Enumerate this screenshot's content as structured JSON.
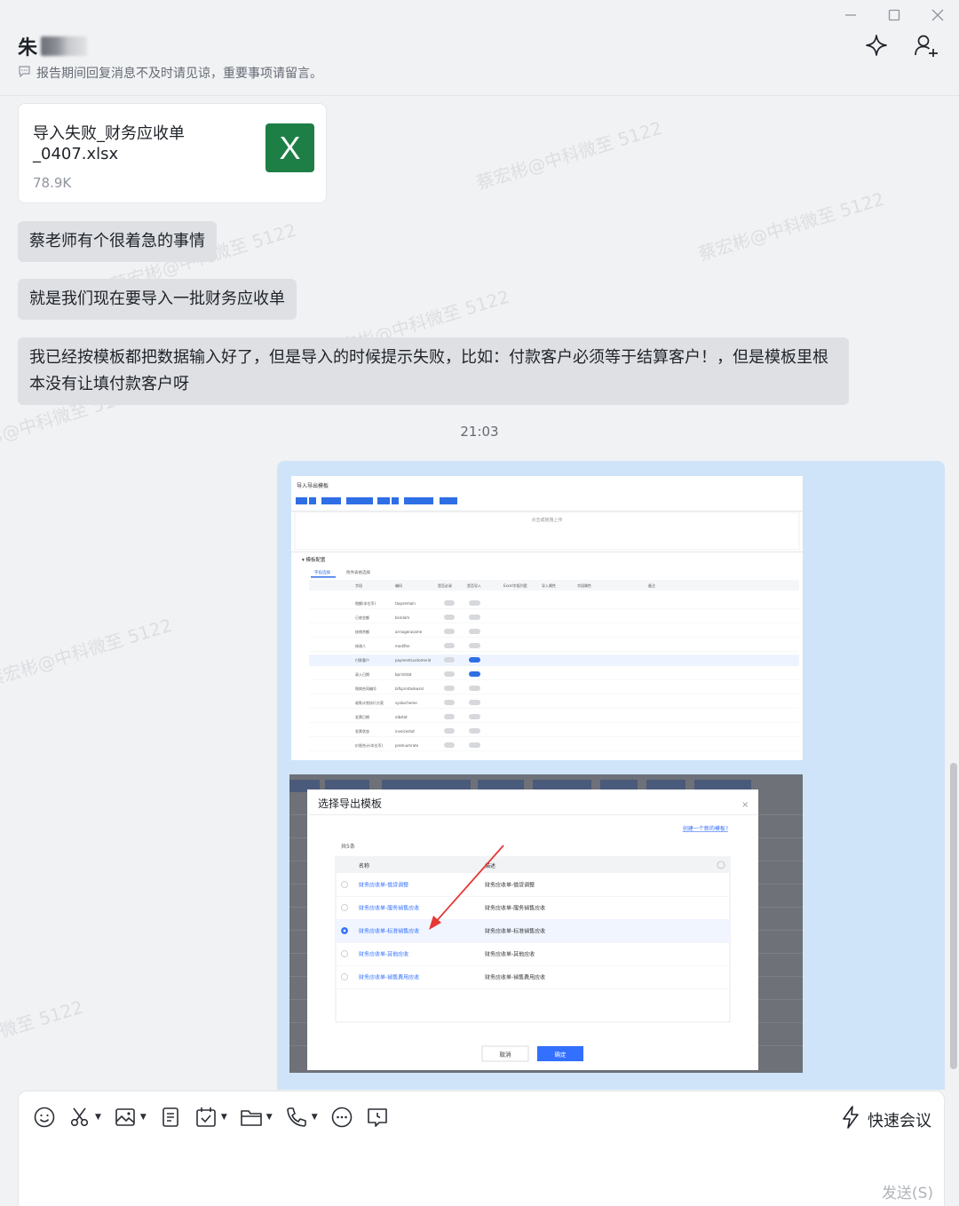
{
  "header": {
    "contact_name": "朱",
    "status": "报告期间回复消息不及时请见谅，重要事项请留言。"
  },
  "messages": {
    "file": {
      "name": "导入失败_财务应收单_0407.xlsx",
      "size": "78.9K",
      "icon": "excel-file-icon"
    },
    "texts": [
      "蔡老师有个很着急的事情",
      "就是我们现在要导入一批财务应收单",
      "我已经按模板都把数据输入好了，但是导入的时候提示失败，比如：付款客户必须等于结算客户！，但是模板里根本没有让填付款客户呀"
    ],
    "timestamp": "21:03",
    "watermark": "蔡宏彬@中科微至 5122"
  },
  "screenshot1": {
    "title": "导入导出模板",
    "upload_hint": "点击或拖拽上传",
    "section": "模板配置",
    "tabs": [
      "字段选择",
      "附件表格选择"
    ],
    "columns": [
      "字段",
      "编码",
      "是否必录",
      "是否导入",
      "Excel字段列宽",
      "导入属性",
      "字段属性",
      "备注"
    ],
    "rows": [
      {
        "name": "税额(本位币)",
        "code": "taxpremain",
        "on": false
      },
      {
        "name": "已收金额",
        "code": "bsrolam",
        "on": false
      },
      {
        "name": "核销余额",
        "code": "arrsagerasame",
        "on": false
      },
      {
        "name": "修改人",
        "code": "modifier",
        "on": false
      },
      {
        "name": "付款客户",
        "code": "paymentcustomerid",
        "on": true
      },
      {
        "name": "录入日期",
        "code": "bprintdat",
        "on": true
      },
      {
        "name": "购销合同编号",
        "code": "bifsprintaskwral",
        "on": false
      },
      {
        "name": "收款计划执行方案",
        "code": "sysbscheme",
        "on": false
      },
      {
        "name": "发票日期",
        "code": "elbstat",
        "on": false
      },
      {
        "name": "发票状态",
        "code": "invoicestat",
        "on": false
      },
      {
        "name": "价税合计(本位币)",
        "code": "premiumrate",
        "on": false
      }
    ]
  },
  "dialog": {
    "title": "选择导出模板",
    "create_link": "创建一个新的模板?",
    "count": "共5条",
    "col_name": "名称",
    "col_desc": "描述",
    "items": [
      {
        "name": "财务应收单-借贷调整",
        "desc": "财务应收单-借贷调整",
        "selected": false
      },
      {
        "name": "财务应收单-服务销售应收",
        "desc": "财务应收单-服务销售应收",
        "selected": false
      },
      {
        "name": "财务应收单-标准销售应收",
        "desc": "财务应收单-标准销售应收",
        "selected": true
      },
      {
        "name": "财务应收单-其他应收",
        "desc": "财务应收单-其他应收",
        "selected": false
      },
      {
        "name": "财务应收单-销售费用应收",
        "desc": "财务应收单-销售费用应收",
        "selected": false
      }
    ],
    "cancel": "取消",
    "confirm": "确定"
  },
  "composer": {
    "tools": [
      "emoji-icon",
      "scissors-icon",
      "image-icon",
      "document-icon",
      "task-icon",
      "folder-icon",
      "phone-icon",
      "more-icon",
      "history-icon"
    ],
    "quick_meeting": "快速会议",
    "send": "发送(S)"
  },
  "colors": {
    "bubble": "#dee0e3",
    "image_bg": "#cfe4f9",
    "excel_green": "#1d7f45",
    "link_blue": "#3370ff"
  }
}
